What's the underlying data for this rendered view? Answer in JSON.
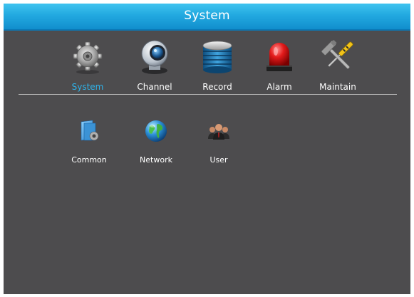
{
  "window": {
    "title": "System"
  },
  "topnav": {
    "items": [
      {
        "label": "System",
        "icon": "gear-icon",
        "active": true
      },
      {
        "label": "Channel",
        "icon": "camera-icon",
        "active": false
      },
      {
        "label": "Record",
        "icon": "hard-drive-icon",
        "active": false
      },
      {
        "label": "Alarm",
        "icon": "alarm-siren-icon",
        "active": false
      },
      {
        "label": "Maintain",
        "icon": "tools-icon",
        "active": false
      }
    ]
  },
  "subnav": {
    "items": [
      {
        "label": "Common",
        "icon": "folder-settings-icon"
      },
      {
        "label": "Network",
        "icon": "globe-icon"
      },
      {
        "label": "User",
        "icon": "users-icon"
      }
    ]
  },
  "colors": {
    "background": "#4d4c4e",
    "titlebar": "#22a9e0",
    "active_label": "#2fb2e8",
    "text": "#ffffff"
  }
}
